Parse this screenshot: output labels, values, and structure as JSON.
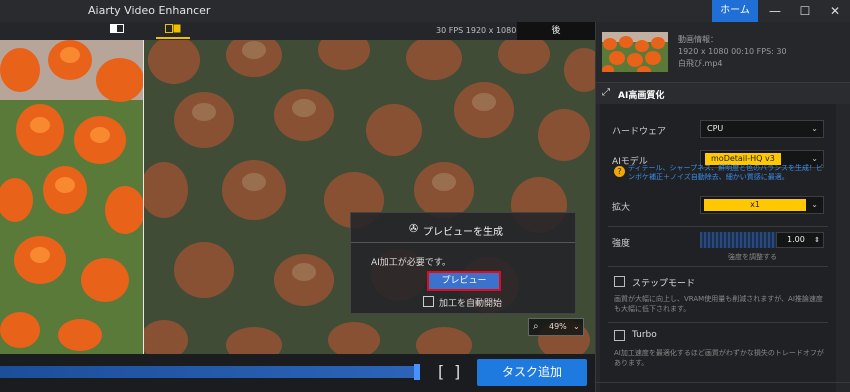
{
  "app": {
    "title": "Aiarty Video Enhancer",
    "home": "ホーム"
  },
  "window": {
    "minimize": "—",
    "maximize": "☐",
    "close": "✕"
  },
  "view": {
    "fps_text": "30 FPS  1920 x 1080",
    "after_tab": "後"
  },
  "dialog": {
    "title": "プレビューを生成",
    "message": "AI加工が必要です。",
    "preview_button": "プレビュー",
    "auto_start_label": "加工を自動開始"
  },
  "zoom": {
    "value": "49%"
  },
  "bottom": {
    "bracket_open": "[",
    "bracket_close": "]",
    "task_add": "タスク追加"
  },
  "video_info": {
    "heading": "動画情報：",
    "line1": "1920 x 1080  00:10   FPS: 30",
    "filename": "白飛び.mp4"
  },
  "section": {
    "title": "AI高画質化"
  },
  "settings": {
    "hardware_label": "ハードウェア",
    "hardware_value": "CPU",
    "model_label": "AIモデル",
    "model_value": "moDetail-HQ  v3",
    "model_hint": "ディテール、シャープネス、鮮明度と色のバランスを生成！ピンボケ補正＋ノイズ自動除去、細かい質感に最適。",
    "scale_label": "拡大",
    "scale_value": "x1",
    "strength_label": "強度",
    "strength_value": "1.00",
    "strength_hint": "強度を調整する",
    "step_label": "ステップモード",
    "step_desc": "画質が大幅に向上し、VRAM使用量も削減されますが、AI推論速度も大幅に低下されます。",
    "turbo_label": "Turbo",
    "turbo_desc": "AI加工速度を最適化するほど画質がわずかな損失のトレードオフがあります。"
  }
}
